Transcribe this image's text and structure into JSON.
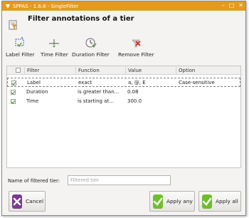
{
  "window": {
    "title": "SPPAS - 1.6.8 - SingleFilter",
    "controls": {
      "minimize": "–",
      "maximize": "□",
      "close": "✕"
    }
  },
  "header": {
    "title": "Filter annotations of a tier",
    "icon": "filter-document-icon"
  },
  "toolbar": {
    "label_filter": "Label Filter",
    "time_filter": "Time Filter",
    "duration_filter": "Duration Filter",
    "remove_filter": "Remove Filter"
  },
  "table": {
    "columns": [
      "Filter",
      "Function",
      "Value",
      "Option"
    ],
    "rows": [
      {
        "checked": true,
        "filter": "Label",
        "function": "exact",
        "value": "a, @, E",
        "option": "Case-sensitive"
      },
      {
        "checked": true,
        "filter": "Duration",
        "function": "is greater than...",
        "value": "0.08",
        "option": ""
      },
      {
        "checked": true,
        "filter": "Time",
        "function": "is starting at...",
        "value": "300.0",
        "option": ""
      }
    ]
  },
  "filtered_tier": {
    "label": "Name of filtered tier:",
    "placeholder": "Filtered tier",
    "value": ""
  },
  "buttons": {
    "cancel": "Cancel",
    "apply_any": "Apply any",
    "apply_all": "Apply all"
  },
  "colors": {
    "titlebar": "#e59a1e",
    "cancel_icon": "#7a3b8f",
    "apply_icon": "#6fbf2c"
  }
}
